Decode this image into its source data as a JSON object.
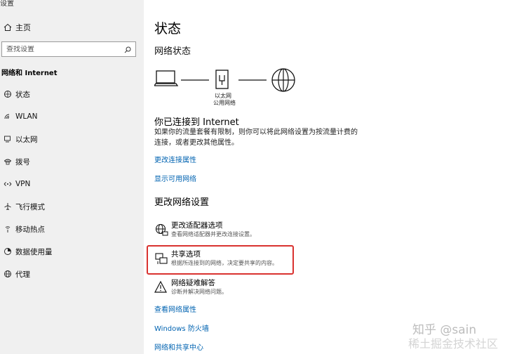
{
  "app": {
    "title": "设置"
  },
  "sidebar": {
    "home_label": "主页",
    "search_placeholder": "查找设置",
    "section_title": "网络和 Internet",
    "items": [
      {
        "label": "状态",
        "icon": "status-icon"
      },
      {
        "label": "WLAN",
        "icon": "wifi-icon"
      },
      {
        "label": "以太网",
        "icon": "ethernet-icon"
      },
      {
        "label": "拨号",
        "icon": "dialup-icon"
      },
      {
        "label": "VPN",
        "icon": "vpn-icon"
      },
      {
        "label": "飞行模式",
        "icon": "airplane-icon"
      },
      {
        "label": "移动热点",
        "icon": "hotspot-icon"
      },
      {
        "label": "数据使用量",
        "icon": "data-usage-icon"
      },
      {
        "label": "代理",
        "icon": "proxy-icon"
      }
    ]
  },
  "main": {
    "title": "状态",
    "network_status_title": "网络状态",
    "ethernet_name": "以太网",
    "network_type": "公用网络",
    "connected_title": "你已连接到 Internet",
    "connected_desc": "如果你的流量套餐有限制，则你可以将此网络设置为按流量计费的连接，或者更改其他属性。",
    "link_change_props": "更改连接属性",
    "link_show_networks": "显示可用网络",
    "change_settings_title": "更改网络设置",
    "settings": [
      {
        "name": "更改适配器选项",
        "desc": "查看网络适配器并更改连接设置。",
        "icon": "adapter-icon"
      },
      {
        "name": "共享选项",
        "desc": "根据所连接到的网络，决定要共享的内容。",
        "icon": "sharing-icon"
      },
      {
        "name": "网络疑难解答",
        "desc": "诊断并解决网络问题。",
        "icon": "warning-icon"
      }
    ],
    "link_hardware_props": "查看网络属性",
    "link_firewall": "Windows 防火墙",
    "link_sharing_center": "网络和共享中心"
  },
  "watermark": {
    "line1": "知乎 @sain",
    "line2": "稀土掘金技术社区"
  },
  "colors": {
    "sidebar_bg": "#f0f0f0",
    "link": "#0063b1",
    "highlight": "#d9322f"
  }
}
